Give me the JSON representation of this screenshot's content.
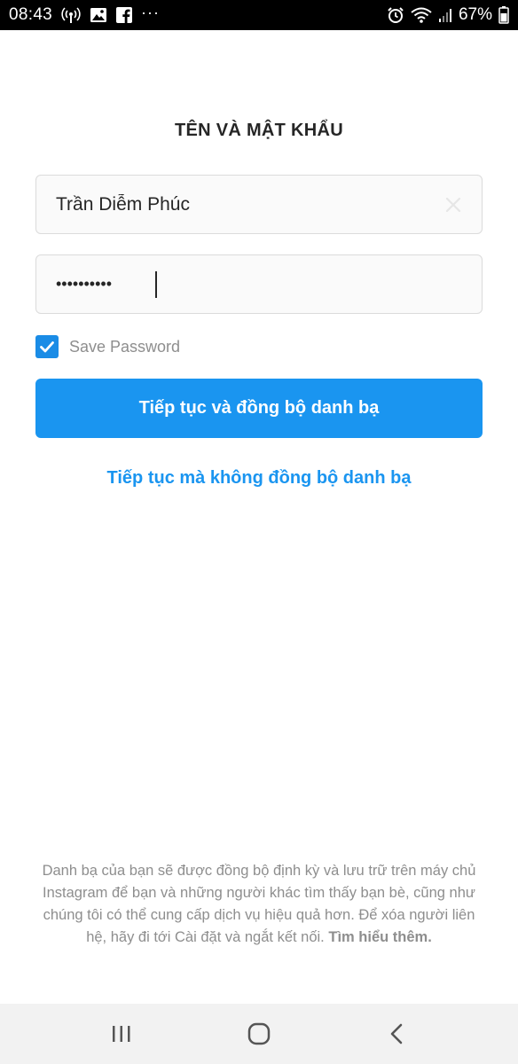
{
  "status_bar": {
    "time": "08:43",
    "battery": "67%",
    "more": "···",
    "icons": [
      "wifi-hotspot-icon",
      "image-icon",
      "facebook-icon",
      "alarm-icon",
      "wifi-icon",
      "signal-icon"
    ]
  },
  "page": {
    "title": "TÊN VÀ MẬT KHẨU"
  },
  "form": {
    "name_value": "Trần Diễm Phúc",
    "password_masked": "••••••••••",
    "save_password_label": "Save Password",
    "save_password_checked": true
  },
  "actions": {
    "primary_label": "Tiếp tục và đồng bộ danh bạ",
    "secondary_label": "Tiếp tục mà không đồng bộ danh bạ"
  },
  "footer": {
    "text": "Danh bạ của bạn sẽ được đồng bộ định kỳ và lưu trữ trên máy chủ Instagram để bạn và những người khác tìm thấy bạn bè, cũng như chúng tôi có thể cung cấp dịch vụ hiệu quả hơn. Để xóa người liên hệ, hãy đi tới Cài đặt và ngắt kết nối.",
    "learn_more": "Tìm hiểu thêm."
  },
  "nav_bar": {
    "icons": [
      "recent-apps-icon",
      "home-icon",
      "back-icon"
    ]
  },
  "colors": {
    "accent": "#1a95f0",
    "checkbox": "#1a8ce6",
    "muted_text": "#8e8e8e",
    "field_bg": "#fafafa",
    "field_border": "#dbdbdb"
  }
}
